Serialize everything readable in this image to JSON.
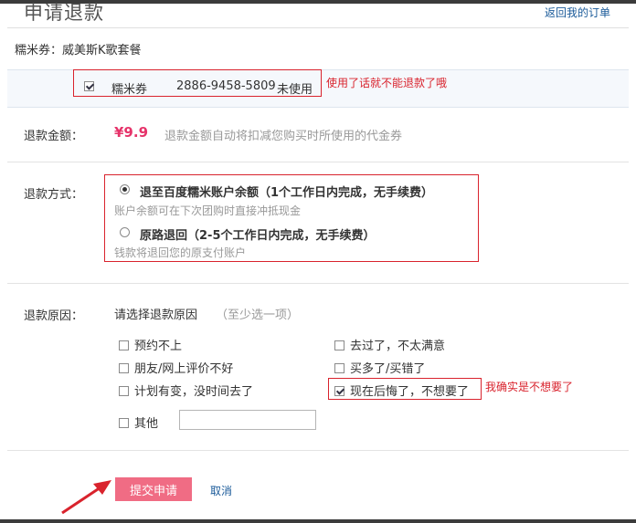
{
  "page": {
    "title": "申请退款",
    "back_link": "返回我的订单"
  },
  "coupon": {
    "label": "糯米券：威美斯K歌套餐",
    "item_name": "糯米券",
    "code": "2886-9458-5809",
    "status": "未使用",
    "checked": true,
    "annotation": "使用了话就不能退款了哦"
  },
  "refund_amount": {
    "label": "退款金额：",
    "value": "¥9.9",
    "note": "退款金额自动将扣减您购买时所使用的代金券"
  },
  "refund_method": {
    "label": "退款方式：",
    "options": [
      {
        "title": "退至百度糯米账户余额（1个工作日内完成，无手续费）",
        "desc": "账户余额可在下次团购时直接冲抵现金",
        "selected": true
      },
      {
        "title": "原路退回（2-5个工作日内完成，无手续费）",
        "desc": "钱款将退回您的原支付账户",
        "selected": false
      }
    ]
  },
  "refund_reason": {
    "label": "退款原因：",
    "prompt": "请选择退款原因",
    "hint": "（至少选一项）",
    "reasons": [
      {
        "text": "预约不上",
        "checked": false
      },
      {
        "text": "去过了，不太满意",
        "checked": false
      },
      {
        "text": "朋友/网上评价不好",
        "checked": false
      },
      {
        "text": "买多了/买错了",
        "checked": false
      },
      {
        "text": "计划有变，没时间去了",
        "checked": false
      },
      {
        "text": "现在后悔了，不想要了",
        "checked": true
      },
      {
        "text": "其他",
        "checked": false
      }
    ],
    "other_value": "",
    "annotation": "我确实是不想要了"
  },
  "actions": {
    "submit_label": "提交申请",
    "cancel_label": "取消"
  },
  "colors": {
    "accent_red": "#d9232d",
    "price_pink": "#e6336a",
    "submit_bg": "#f06c84",
    "link_blue": "#1a5a99"
  },
  "icons": {
    "arrow": "red-arrow-pointing-to-submit"
  }
}
